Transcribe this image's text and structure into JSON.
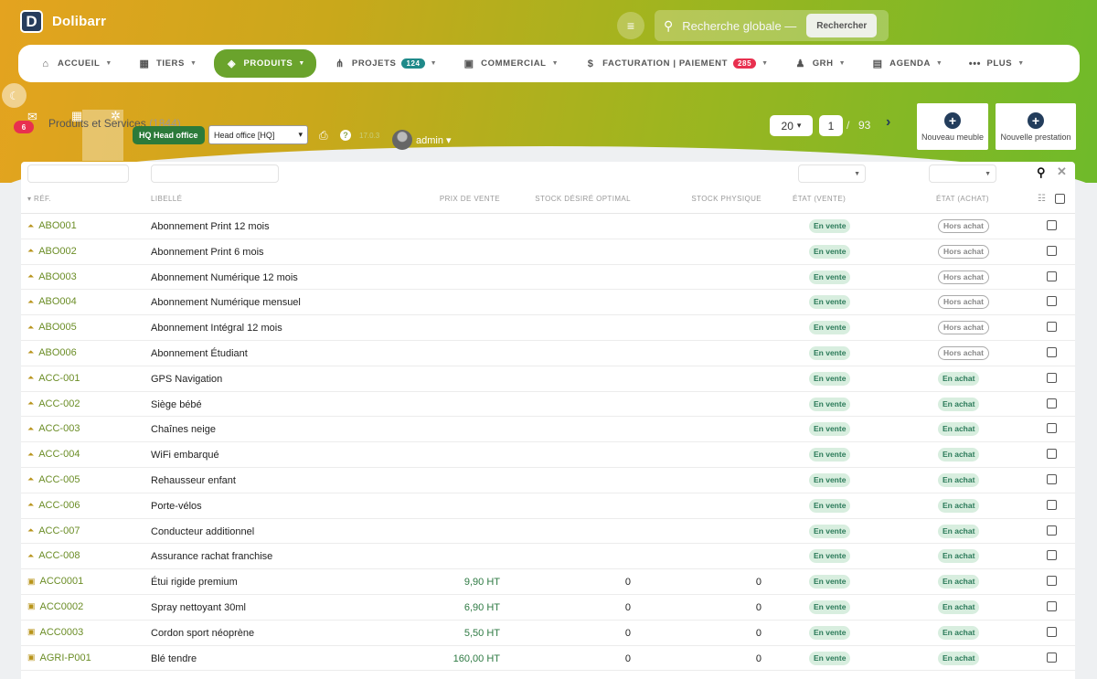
{
  "app": {
    "name": "Dolibarr",
    "logo_letter": "D"
  },
  "search": {
    "placeholder": "Recherche globale — c",
    "button": "Rechercher"
  },
  "nav": [
    {
      "label": "ACCUEIL",
      "icon": "home-icon",
      "glyph": "⌂"
    },
    {
      "label": "TIERS",
      "icon": "building-icon",
      "glyph": "▦"
    },
    {
      "label": "PRODUITS",
      "icon": "cube-icon",
      "glyph": "◈",
      "active": true
    },
    {
      "label": "PROJETS",
      "icon": "sitemap-icon",
      "glyph": "⋔",
      "badge": "124",
      "badge_color": "#1f8a8a"
    },
    {
      "label": "COMMERCIAL",
      "icon": "briefcase-icon",
      "glyph": "▣"
    },
    {
      "label": "FACTURATION | PAIEMENT",
      "icon": "invoice-icon",
      "glyph": "$",
      "badge": "285",
      "badge_color": "#e8304f"
    },
    {
      "label": "GRH",
      "icon": "user-tie-icon",
      "glyph": "♟"
    },
    {
      "label": "AGENDA",
      "icon": "calendar-icon",
      "glyph": "▤"
    },
    {
      "label": "PLUS",
      "icon": "ellipsis-icon",
      "glyph": "•••"
    }
  ],
  "toolbar": {
    "chat_count": "6",
    "page_title": "Produits et Services",
    "title_count": "(1844)",
    "entity_badge": "HQ Head office",
    "entity_select": "Head office [HQ]",
    "version": "17.0.3",
    "user": "admin"
  },
  "pagination": {
    "per_page": "20",
    "page": "1",
    "separator": "/",
    "total_pages": "93"
  },
  "actions": {
    "new_product": "Nouveau meuble",
    "new_service": "Nouvelle prestation"
  },
  "columns": {
    "ref": "RÉF.",
    "label": "LIBELLÉ",
    "price": "PRIX DE VENTE",
    "stock_desired": "STOCK DÉSIRÉ OPTIMAL",
    "stock_physical": "STOCK PHYSIQUE",
    "status_sell": "ÉTAT (VENTE)",
    "status_buy": "ÉTAT (ACHAT)"
  },
  "status_colors": {
    "green_badge_bg": "#d8eedf",
    "green_badge_text": "#2b7a59",
    "ref_link": "#6b8d26"
  },
  "rows": [
    {
      "ref": "ABO001",
      "label": "Abonnement Print 12 mois",
      "price": "",
      "stock_desired": "",
      "stock_physical": "",
      "sell": "En vente",
      "buy": "Hors achat",
      "type": "service"
    },
    {
      "ref": "ABO002",
      "label": "Abonnement Print 6 mois",
      "price": "",
      "stock_desired": "",
      "stock_physical": "",
      "sell": "En vente",
      "buy": "Hors achat",
      "type": "service"
    },
    {
      "ref": "ABO003",
      "label": "Abonnement Numérique 12 mois",
      "price": "",
      "stock_desired": "",
      "stock_physical": "",
      "sell": "En vente",
      "buy": "Hors achat",
      "type": "service"
    },
    {
      "ref": "ABO004",
      "label": "Abonnement Numérique mensuel",
      "price": "",
      "stock_desired": "",
      "stock_physical": "",
      "sell": "En vente",
      "buy": "Hors achat",
      "type": "service"
    },
    {
      "ref": "ABO005",
      "label": "Abonnement Intégral 12 mois",
      "price": "",
      "stock_desired": "",
      "stock_physical": "",
      "sell": "En vente",
      "buy": "Hors achat",
      "type": "service"
    },
    {
      "ref": "ABO006",
      "label": "Abonnement Étudiant",
      "price": "",
      "stock_desired": "",
      "stock_physical": "",
      "sell": "En vente",
      "buy": "Hors achat",
      "type": "service"
    },
    {
      "ref": "ACC-001",
      "label": "GPS Navigation",
      "price": "",
      "stock_desired": "",
      "stock_physical": "",
      "sell": "En vente",
      "buy": "En achat",
      "type": "service"
    },
    {
      "ref": "ACC-002",
      "label": "Siège bébé",
      "price": "",
      "stock_desired": "",
      "stock_physical": "",
      "sell": "En vente",
      "buy": "En achat",
      "type": "service"
    },
    {
      "ref": "ACC-003",
      "label": "Chaînes neige",
      "price": "",
      "stock_desired": "",
      "stock_physical": "",
      "sell": "En vente",
      "buy": "En achat",
      "type": "service"
    },
    {
      "ref": "ACC-004",
      "label": "WiFi embarqué",
      "price": "",
      "stock_desired": "",
      "stock_physical": "",
      "sell": "En vente",
      "buy": "En achat",
      "type": "service"
    },
    {
      "ref": "ACC-005",
      "label": "Rehausseur enfant",
      "price": "",
      "stock_desired": "",
      "stock_physical": "",
      "sell": "En vente",
      "buy": "En achat",
      "type": "service"
    },
    {
      "ref": "ACC-006",
      "label": "Porte-vélos",
      "price": "",
      "stock_desired": "",
      "stock_physical": "",
      "sell": "En vente",
      "buy": "En achat",
      "type": "service"
    },
    {
      "ref": "ACC-007",
      "label": "Conducteur additionnel",
      "price": "",
      "stock_desired": "",
      "stock_physical": "",
      "sell": "En vente",
      "buy": "En achat",
      "type": "service"
    },
    {
      "ref": "ACC-008",
      "label": "Assurance rachat franchise",
      "price": "",
      "stock_desired": "",
      "stock_physical": "",
      "sell": "En vente",
      "buy": "En achat",
      "type": "service"
    },
    {
      "ref": "ACC0001",
      "label": "Étui rigide premium",
      "price": "9,90 HT",
      "stock_desired": "0",
      "stock_physical": "0",
      "sell": "En vente",
      "buy": "En achat",
      "type": "product"
    },
    {
      "ref": "ACC0002",
      "label": "Spray nettoyant 30ml",
      "price": "6,90 HT",
      "stock_desired": "0",
      "stock_physical": "0",
      "sell": "En vente",
      "buy": "En achat",
      "type": "product"
    },
    {
      "ref": "ACC0003",
      "label": "Cordon sport néoprène",
      "price": "5,50 HT",
      "stock_desired": "0",
      "stock_physical": "0",
      "sell": "En vente",
      "buy": "En achat",
      "type": "product"
    },
    {
      "ref": "AGRI-P001",
      "label": "Blé tendre",
      "price": "160,00 HT",
      "stock_desired": "0",
      "stock_physical": "0",
      "sell": "En vente",
      "buy": "En achat",
      "type": "product"
    }
  ]
}
